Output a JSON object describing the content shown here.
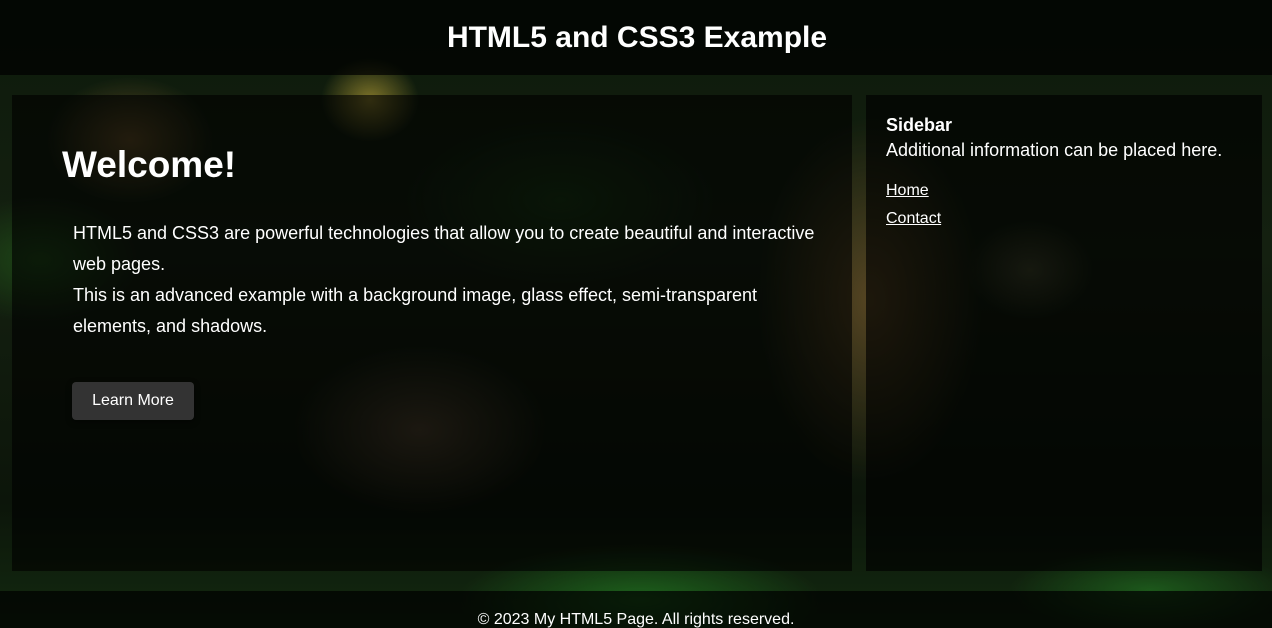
{
  "header": {
    "title": "HTML5 and CSS3 Example"
  },
  "main": {
    "heading": "Welcome!",
    "paragraph_1": "HTML5 and CSS3 are powerful technologies that allow you to create beautiful and interactive web pages.",
    "paragraph_2": "This is an advanced example with a background image, glass effect, semi-transparent elements, and shadows.",
    "button_label": "Learn More"
  },
  "sidebar": {
    "heading": "Sidebar",
    "info": "Additional information can be placed here.",
    "links": [
      {
        "label": "Home"
      },
      {
        "label": "Contact"
      }
    ]
  },
  "footer": {
    "text": "© 2023 My HTML5 Page. All rights reserved."
  }
}
